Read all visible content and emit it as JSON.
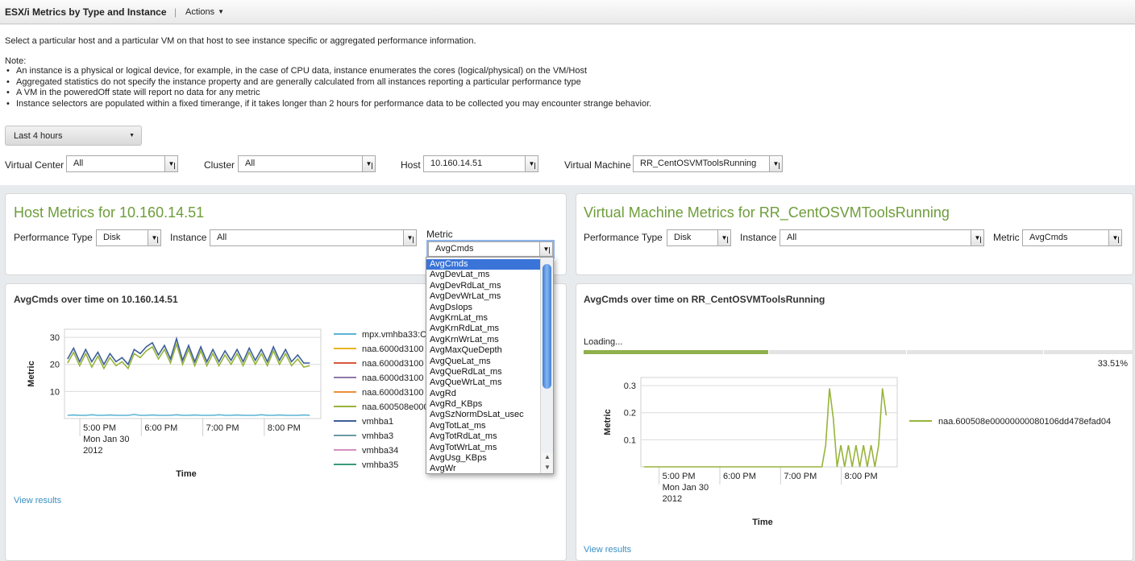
{
  "header": {
    "title": "ESX/i Metrics by Type and Instance",
    "separator": "|",
    "actions_label": "Actions"
  },
  "intro": {
    "description": "Select a particular host and a particular VM on that host to see instance specific or aggregated performance information.",
    "note_label": "Note:",
    "notes": [
      "An instance is a physical or logical device, for example, in the case of CPU data, instance enumerates the cores (logical/physical) on the VM/Host",
      "Aggregated statistics do not specify the instance property and are generally calculated from all instances reporting a particular performance type",
      "A VM in the poweredOff state will report no data for any metric",
      "Instance selectors are populated within a fixed timerange, if it takes longer than 2 hours for performance data to be collected you may encounter strange behavior."
    ]
  },
  "time_range": {
    "value": "Last 4 hours"
  },
  "filters": {
    "virtual_center": {
      "label": "Virtual Center",
      "value": "All"
    },
    "cluster": {
      "label": "Cluster",
      "value": "All"
    },
    "host": {
      "label": "Host",
      "value": "10.160.14.51"
    },
    "virtual_machine": {
      "label": "Virtual Machine",
      "value": "RR_CentOSVMToolsRunning"
    }
  },
  "host_panel": {
    "title": "Host Metrics for 10.160.14.51",
    "performance_type_label": "Performance Type",
    "performance_type_value": "Disk",
    "instance_label": "Instance",
    "instance_value": "All",
    "metric_label": "Metric",
    "metric_value": "AvgCmds",
    "metric_options": [
      "AvgCmds",
      "AvgDevLat_ms",
      "AvgDevRdLat_ms",
      "AvgDevWrLat_ms",
      "AvgDsIops",
      "AvgKrnLat_ms",
      "AvgKrnRdLat_ms",
      "AvgKrnWrLat_ms",
      "AvgMaxQueDepth",
      "AvgQueLat_ms",
      "AvgQueRdLat_ms",
      "AvgQueWrLat_ms",
      "AvgRd",
      "AvgRd_KBps",
      "AvgSzNormDsLat_usec",
      "AvgTotLat_ms",
      "AvgTotRdLat_ms",
      "AvgTotWrLat_ms",
      "AvgUsg_KBps",
      "AvgWr"
    ]
  },
  "vm_panel": {
    "title": "Virtual Machine Metrics for RR_CentOSVMToolsRunning",
    "performance_type_label": "Performance Type",
    "performance_type_value": "Disk",
    "instance_label": "Instance",
    "instance_value": "All",
    "metric_label": "Metric",
    "metric_value": "AvgCmds"
  },
  "host_chart": {
    "title": "AvgCmds over time on 10.160.14.51",
    "view_results": "View results"
  },
  "vm_chart": {
    "title": "AvgCmds over time on RR_CentOSVMToolsRunning",
    "loading_text": "Loading...",
    "progress": 33.51,
    "progress_text": "33.51%",
    "view_results": "View results"
  },
  "colors": {
    "accent_green": "#6e9d3a",
    "link_blue": "#3a8fc2",
    "selection_blue": "#3a74d8"
  },
  "chart_data": [
    {
      "type": "line",
      "xlabel": "Time",
      "ylabel": "Metric",
      "ylim": [
        0,
        33
      ],
      "yticks": [
        10,
        20,
        30
      ],
      "xticks": [
        "5:00 PM",
        "6:00 PM",
        "7:00 PM",
        "8:00 PM"
      ],
      "x_first_tick_sublabel": [
        "Mon Jan 30",
        "2012"
      ],
      "xlim_hours": [
        16.75,
        20.92
      ],
      "grid": true,
      "legend_position": "right",
      "series": [
        {
          "name": "mpx.vmhba33:C",
          "color": "#5bb4d4",
          "values": [
            1.2,
            1.3,
            1.2,
            1.2,
            1.4,
            1.2,
            1.2,
            1.3,
            1.2,
            1.2,
            1.2,
            1.5,
            1.2,
            1.2,
            1.3,
            1.2,
            1.2,
            1.2,
            1.4,
            1.2,
            1.2,
            1.3,
            1.2,
            1.2,
            1.2,
            1.4,
            1.2,
            1.2,
            1.3,
            1.2,
            1.2,
            1.2,
            1.4,
            1.2,
            1.2,
            1.3,
            1.2,
            1.2,
            1.2,
            1.3,
            1.2
          ]
        },
        {
          "name": "naa.6000d3100",
          "color": "#e8b424",
          "values": []
        },
        {
          "name": "naa.6000d3100",
          "color": "#d8573a",
          "values": []
        },
        {
          "name": "naa.6000d3100",
          "color": "#8d7aa8",
          "values": []
        },
        {
          "name": "naa.6000d3100",
          "color": "#ee8f3a",
          "values": []
        },
        {
          "name": "naa.600508e000",
          "color": "#97b43a",
          "values": [
            20.5,
            24.5,
            19.5,
            24,
            19,
            23,
            18.5,
            22.5,
            19.5,
            21,
            18.5,
            24,
            22.5,
            25,
            26.5,
            22,
            25.5,
            20.5,
            27.5,
            20,
            25.5,
            19.5,
            25,
            19.5,
            24,
            19.5,
            23.5,
            20,
            24,
            19.5,
            24.5,
            20,
            24,
            19.5,
            25,
            20,
            24,
            19.5,
            22,
            19,
            19.5
          ]
        },
        {
          "name": "vmhba1",
          "color": "#3c5e99",
          "values": [
            22,
            26,
            21,
            25.5,
            21,
            24.5,
            20,
            24,
            21,
            22.5,
            20,
            25.5,
            24,
            26.5,
            28,
            23.5,
            27,
            22,
            29.5,
            21.5,
            27,
            21,
            26.5,
            21,
            25.5,
            21,
            25,
            21.5,
            25.5,
            21,
            26,
            21.5,
            25.5,
            21,
            26.5,
            21.5,
            25.5,
            21,
            23.5,
            20.5,
            20.5
          ]
        },
        {
          "name": "vmhba3",
          "color": "#6a9aa8",
          "values": []
        },
        {
          "name": "vmhba34",
          "color": "#d48fc0",
          "values": []
        },
        {
          "name": "vmhba35",
          "color": "#3c9a7a",
          "values": []
        }
      ]
    },
    {
      "type": "line",
      "xlabel": "Time",
      "ylabel": "Metric",
      "ylim": [
        0,
        0.33
      ],
      "yticks": [
        0.1,
        0.2,
        0.3
      ],
      "xticks": [
        "5:00 PM",
        "6:00 PM",
        "7:00 PM",
        "8:00 PM"
      ],
      "x_first_tick_sublabel": [
        "Mon Jan 30",
        "2012"
      ],
      "xlim_hours": [
        16.7,
        20.92
      ],
      "grid": true,
      "legend_position": "right",
      "series": [
        {
          "name": "naa.600508e00000000080106dd478efad04",
          "color": "#97b43a",
          "values": [
            0,
            0,
            0,
            0,
            0,
            0,
            0,
            0,
            0,
            0,
            0,
            0,
            0,
            0,
            0,
            0,
            0,
            0,
            0,
            0,
            0,
            0,
            0,
            0,
            0,
            0,
            0,
            0,
            0,
            0,
            0,
            0,
            0,
            0,
            0,
            0,
            0,
            0,
            0,
            0,
            0,
            0,
            0,
            0,
            0,
            0,
            0,
            0,
            0.08,
            0.29,
            0.18,
            0,
            0.08,
            0,
            0.08,
            0,
            0.08,
            0,
            0.08,
            0,
            0.08,
            0,
            0.08,
            0.29,
            0.19
          ]
        }
      ]
    }
  ]
}
